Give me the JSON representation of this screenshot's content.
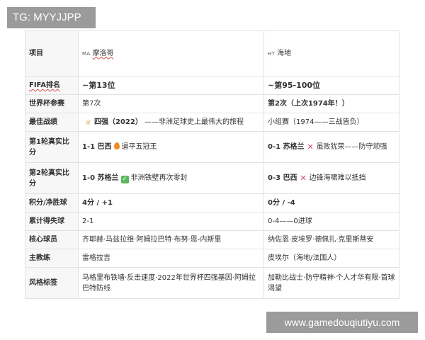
{
  "tag": "TG: MYYJJPP",
  "watermark": "www.gamedouqiutiyu.com",
  "header": {
    "label": "项目",
    "team_a_code": "MA",
    "team_a_name": "摩洛哥",
    "team_b_code": "HT",
    "team_b_name": "海地"
  },
  "rows": {
    "fifa": {
      "label": "FIFA排名",
      "a": "~第13位",
      "b": "~第95-100位"
    },
    "wc_apps": {
      "label": "世界杯参赛",
      "a": "第7次",
      "b": "第2次（上次1974年！）"
    },
    "best": {
      "label": "最佳战绩",
      "a_strong": "四强（2022）",
      "a_rest": "——非洲足球史上最伟大的旅程",
      "b": "小组赛（1974——三战皆负）",
      "a_icon": "trophy-icon"
    },
    "r1": {
      "label": "第1轮真实比分",
      "a_score": "1-1 巴西",
      "a_note": "逼平五冠王",
      "a_icon": "fire-icon",
      "b_score": "0-1 苏格兰",
      "b_note": "虽败犹荣——防守顽强",
      "b_icon": "cross-icon"
    },
    "r2": {
      "label": "第2轮真实比分",
      "a_score": "1-0 苏格兰",
      "a_note": "非洲铁壁再次零封",
      "a_icon": "check-icon",
      "b_score": "0-3 巴西",
      "b_note": "边锋海啸难以抵挡",
      "b_icon": "cross-icon"
    },
    "points": {
      "label": "积分/净胜球",
      "a": "4分 / +1",
      "b": "0分 / -4"
    },
    "goals": {
      "label": "累计得失球",
      "a": "2-1",
      "b": "0-4——0进球"
    },
    "players": {
      "label": "核心球员",
      "a": "齐耶赫·马兹拉维·阿姆拉巴特·布努·恩-内斯里",
      "b": "纳佐恩·皮埃罗·德佩扎·克里斯蒂安"
    },
    "coach": {
      "label": "主教练",
      "a": "雷格拉吉",
      "b": "皮埃尔（海地/法国人）"
    },
    "style": {
      "label": "风格标签",
      "a": "马格里布铁墙·反击速度·2022年世界杯四强基因·阿姆拉巴特防线",
      "b": "加勒比战士·防守精神·个人才华有限·首球渴望"
    }
  }
}
